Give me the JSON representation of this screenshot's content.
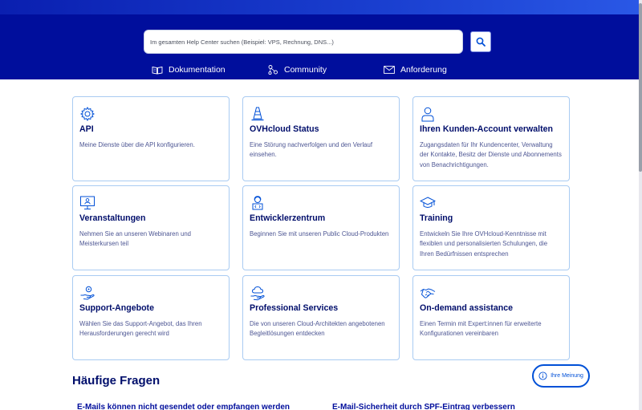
{
  "search": {
    "placeholder": "Im gesamten Help Center suchen (Beispiel: VPS, Rechnung, DNS...)"
  },
  "nav": {
    "items": [
      {
        "label": "Dokumentation",
        "icon": "book-icon"
      },
      {
        "label": "Community",
        "icon": "community-icon"
      },
      {
        "label": "Anforderung",
        "icon": "mail-icon"
      }
    ]
  },
  "cards": [
    {
      "title": "API",
      "desc": "Meine Dienste über die API konfigurieren.",
      "icon": "gear-icon"
    },
    {
      "title": "OVHcloud Status",
      "desc": "Eine Störung nachverfolgen und den Verlauf einsehen.",
      "icon": "traffic-cone-icon"
    },
    {
      "title": "Ihren Kunden-Account verwalten",
      "desc": "Zugangsdaten für Ihr Kundencenter, Verwaltung der Kontakte, Besitz der Dienste und Abonnements von Benachrichtigungen.",
      "icon": "user-icon"
    },
    {
      "title": "Veranstaltungen",
      "desc": "Nehmen Sie an unseren Webinaren und Meisterkursen teil",
      "icon": "monitor-user-icon"
    },
    {
      "title": "Entwicklerzentrum",
      "desc": "Beginnen Sie mit unseren Public Cloud-Produkten",
      "icon": "developer-icon"
    },
    {
      "title": "Training",
      "desc": "Entwickeln Sie Ihre OVHcloud-Kenntnisse mit flexiblen und personalisierten Schulungen, die Ihren Bedürfnissen entsprechen",
      "icon": "graduation-cap-icon"
    },
    {
      "title": "Support-Angebote",
      "desc": "Wählen Sie das Support-Angebot, das Ihren Herausforderungen gerecht wird",
      "icon": "support-hand-icon"
    },
    {
      "title": "Professional Services",
      "desc": "Die von unseren Cloud-Architekten angebotenen Begleitlösungen entdecken",
      "icon": "cloud-hand-icon"
    },
    {
      "title": "On-demand assistance",
      "desc": "Einen Termin mit Expert:innen für erweiterte Konfigurationen vereinbaren",
      "icon": "handshake-icon"
    }
  ],
  "faq": {
    "title": "Häufige Fragen",
    "links": [
      "E-Mails können nicht gesendet oder empfangen werden",
      "E-Mail-Sicherheit durch SPF-Eintrag verbessern"
    ]
  },
  "feedback": {
    "label": "Ihre Meinung"
  },
  "colors": {
    "header_bg": "#000e9c",
    "card_border": "#a9cbf2",
    "title_text": "#000e6b",
    "accent": "#0050d7"
  }
}
